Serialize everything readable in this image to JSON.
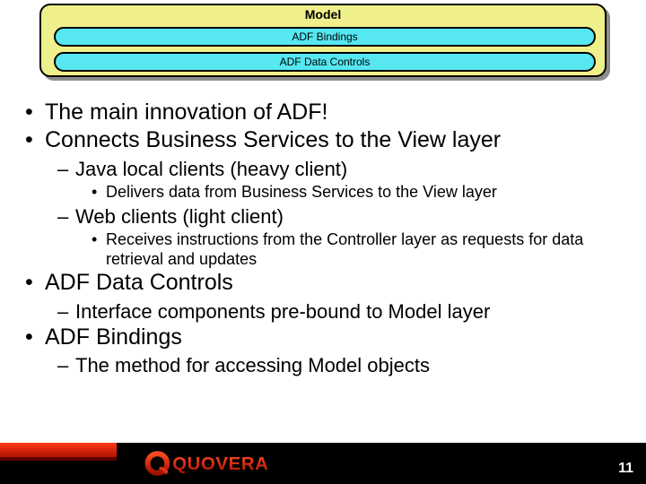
{
  "diagram": {
    "title": "Model",
    "pills": [
      "ADF Bindings",
      "ADF Data Controls"
    ]
  },
  "bullets": {
    "b1": "The main innovation of ADF!",
    "b2": "Connects Business Services to the View layer",
    "b2a": "Java local clients (heavy client)",
    "b2a1": "Delivers data from Business Services to the View layer",
    "b2b": "Web clients (light client)",
    "b2b1": "Receives instructions from the Controller layer as requests for data retrieval and updates",
    "b3": "ADF Data Controls",
    "b3a": "Interface components pre-bound to Model layer",
    "b4": "ADF Bindings",
    "b4a": "The method for accessing Model objects"
  },
  "footer": {
    "logo_text": "Quovera",
    "page_number": "11"
  }
}
